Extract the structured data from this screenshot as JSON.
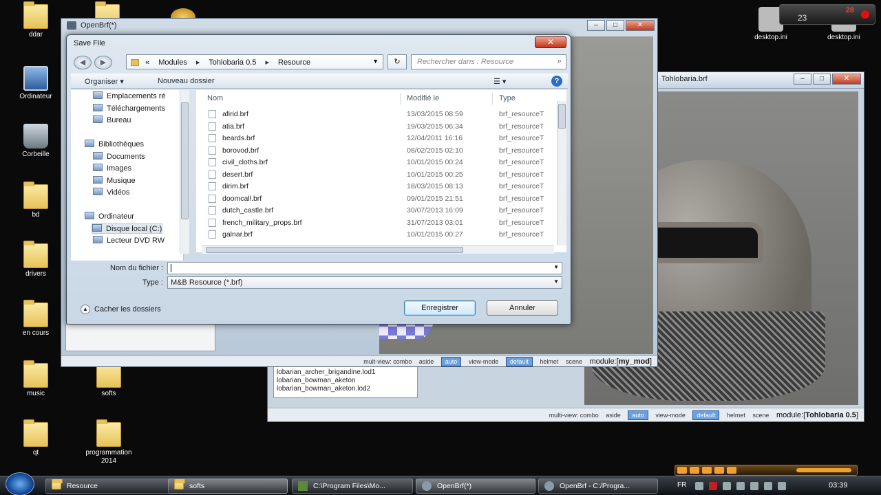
{
  "desktop": {
    "icons": [
      {
        "label": "ddar"
      },
      {
        "label": ""
      },
      {
        "label": "Ordinateur"
      },
      {
        "label": "Corbeille"
      },
      {
        "label": "bd"
      },
      {
        "label": "drivers"
      },
      {
        "label": "en cours"
      },
      {
        "label": "music"
      },
      {
        "label": "softs"
      },
      {
        "label": "qt"
      },
      {
        "label": "programmation 2014"
      },
      {
        "label": "desktop.ini"
      },
      {
        "label": "desktop.ini"
      }
    ],
    "clock_gadget": {
      "date": "23",
      "value": "28"
    }
  },
  "openbrf_main": {
    "title": "OpenBrf(*)",
    "status": {
      "multiview": "mult-view: combo",
      "aside": "aside",
      "auto": "auto",
      "viewmode": "view-mode",
      "default": "default",
      "helmet": "helmet",
      "scene": "scene",
      "module_prefix": "module:[",
      "module_name": "my_mod",
      "module_suffix": "]"
    }
  },
  "openbrf_second": {
    "title": "Tohlobaria.brf",
    "list_items": [
      "lobarian_archer_brigandine.lod1",
      "lobarian_bowman_aketon",
      "lobarian_bowman_aketon.lod2"
    ],
    "status": {
      "multiview": "multi-view: combo",
      "aside": "aside",
      "auto": "auto",
      "viewmode": "view-mode",
      "default": "default",
      "helmet": "helmet",
      "scene": "scene",
      "module_prefix": "module:[",
      "module_name": "Tohlobaria 0.5",
      "module_suffix": "]"
    }
  },
  "dialog": {
    "title": "Save File",
    "close_glyph": "✕",
    "address": {
      "prefix": "«",
      "crumbs": [
        "Modules",
        "Tohlobaria 0.5",
        "Resource"
      ],
      "separator": "▸"
    },
    "refresh_glyph": "↻",
    "search_placeholder": "Rechercher dans : Resource",
    "toolbar": {
      "organiser": "Organiser ▾",
      "new_folder": "Nouveau dossier",
      "view_icon": "views-icon",
      "help": "?"
    },
    "nav_items": [
      {
        "label": "Emplacements ré"
      },
      {
        "label": "Téléchargements"
      },
      {
        "label": "Bureau"
      },
      {
        "label": "Bibliothèques"
      },
      {
        "label": "Documents"
      },
      {
        "label": "Images"
      },
      {
        "label": "Musique"
      },
      {
        "label": "Vidéos"
      },
      {
        "label": "Ordinateur"
      },
      {
        "label": "Disque local (C:)"
      },
      {
        "label": "Lecteur DVD RW"
      }
    ],
    "columns": {
      "name": "Nom",
      "modified": "Modifié le",
      "type": "Type"
    },
    "files": [
      {
        "name": "afirid.brf",
        "date": "13/03/2015 08:59",
        "type": "brf_resourceT"
      },
      {
        "name": "atia.brf",
        "date": "19/03/2015 06:34",
        "type": "brf_resourceT"
      },
      {
        "name": "beards.brf",
        "date": "12/04/2011 16:16",
        "type": "brf_resourceT"
      },
      {
        "name": "borovod.brf",
        "date": "08/02/2015 02:10",
        "type": "brf_resourceT"
      },
      {
        "name": "civil_cloths.brf",
        "date": "10/01/2015 00:24",
        "type": "brf_resourceT"
      },
      {
        "name": "desert.brf",
        "date": "10/01/2015 00:25",
        "type": "brf_resourceT"
      },
      {
        "name": "dirim.brf",
        "date": "18/03/2015 08:13",
        "type": "brf_resourceT"
      },
      {
        "name": "doomcall.brf",
        "date": "09/01/2015 21:51",
        "type": "brf_resourceT"
      },
      {
        "name": "dutch_castle.brf",
        "date": "30/07/2013 16:09",
        "type": "brf_resourceT"
      },
      {
        "name": "french_military_props.brf",
        "date": "31/07/2013 03:01",
        "type": "brf_resourceT"
      },
      {
        "name": "galnar.brf",
        "date": "10/01/2015 00:27",
        "type": "brf_resourceT"
      }
    ],
    "filename_label": "Nom du fichier :",
    "filename_value": "",
    "type_label": "Type :",
    "type_value": "M&B Resource (*.brf)",
    "hide_folders": "Cacher les dossiers",
    "save_button": "Enregistrer",
    "cancel_button": "Annuler"
  },
  "taskbar": {
    "tasks": [
      {
        "label": "Resource"
      },
      {
        "label": "softs"
      },
      {
        "label": "C:\\Program Files\\Mo..."
      },
      {
        "label": "OpenBrf(*)"
      },
      {
        "label": "OpenBrf - C:/Progra..."
      }
    ],
    "lang": "FR",
    "time": "03:39"
  }
}
